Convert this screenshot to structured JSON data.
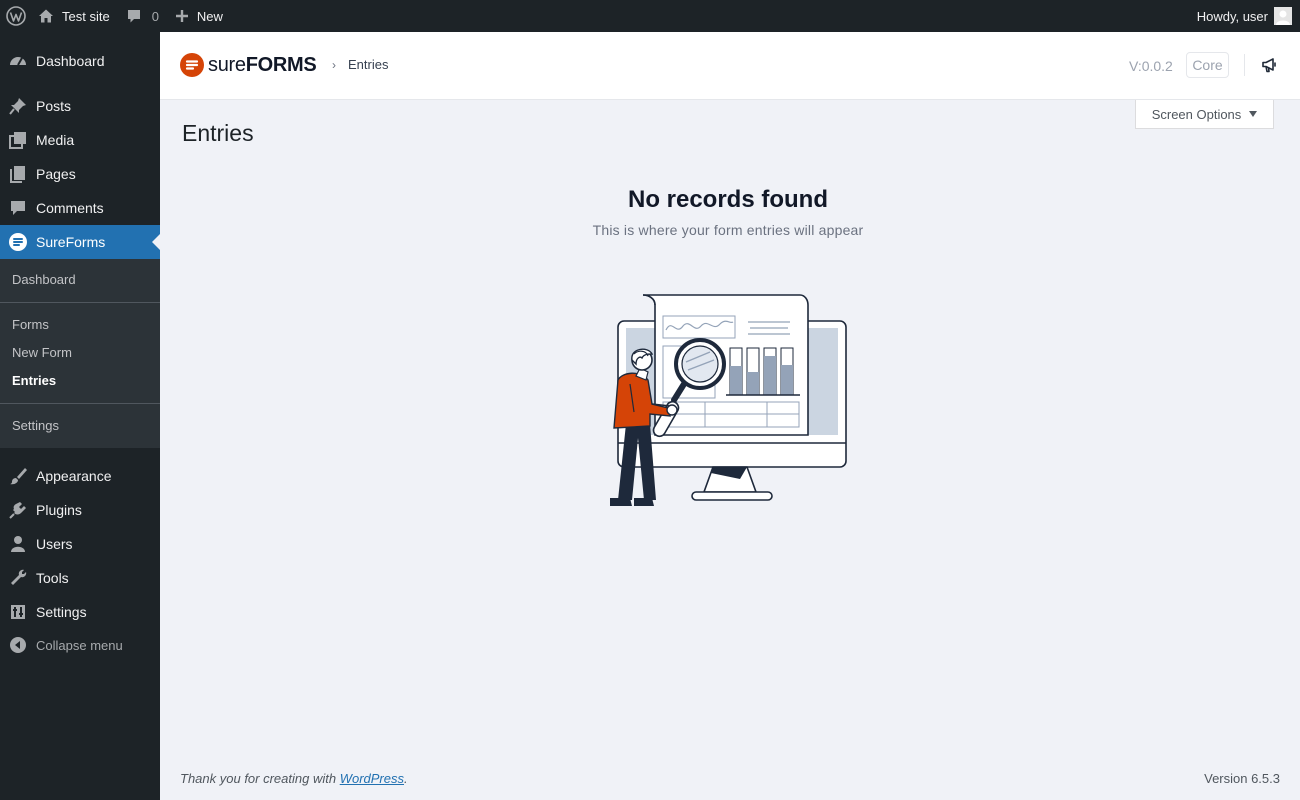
{
  "adminbar": {
    "site_name": "Test site",
    "comments_count": "0",
    "new_label": "New",
    "howdy": "Howdy, user"
  },
  "sidebar": {
    "items": [
      {
        "label": "Dashboard",
        "icon": "dashboard-icon"
      },
      {
        "label": "Posts",
        "icon": "pin-icon"
      },
      {
        "label": "Media",
        "icon": "media-icon"
      },
      {
        "label": "Pages",
        "icon": "pages-icon"
      },
      {
        "label": "Comments",
        "icon": "comment-icon"
      },
      {
        "label": "SureForms",
        "icon": "sureforms-icon"
      },
      {
        "label": "Appearance",
        "icon": "paintbrush-icon"
      },
      {
        "label": "Plugins",
        "icon": "plugin-icon"
      },
      {
        "label": "Users",
        "icon": "user-icon"
      },
      {
        "label": "Tools",
        "icon": "wrench-icon"
      },
      {
        "label": "Settings",
        "icon": "settings-icon"
      }
    ],
    "submenu": [
      "Dashboard",
      "Forms",
      "New Form",
      "Entries",
      "Settings"
    ],
    "collapse_label": "Collapse menu"
  },
  "header": {
    "logo_sure": "sure",
    "logo_forms": "FORMS",
    "breadcrumb_sep": "›",
    "breadcrumb": "Entries",
    "version": "V:0.0.2",
    "badge": "Core"
  },
  "screen_options": "Screen Options",
  "page_title": "Entries",
  "empty_state": {
    "title": "No records found",
    "subtitle": "This is where your form entries will appear"
  },
  "footer": {
    "thanks_prefix": "Thank you for creating with ",
    "wordpress_link": "WordPress",
    "thanks_suffix": ".",
    "version": "Version 6.5.3"
  },
  "colors": {
    "accent": "#2271b1",
    "brand": "#d54407",
    "sidebar_bg": "#1d2327"
  }
}
